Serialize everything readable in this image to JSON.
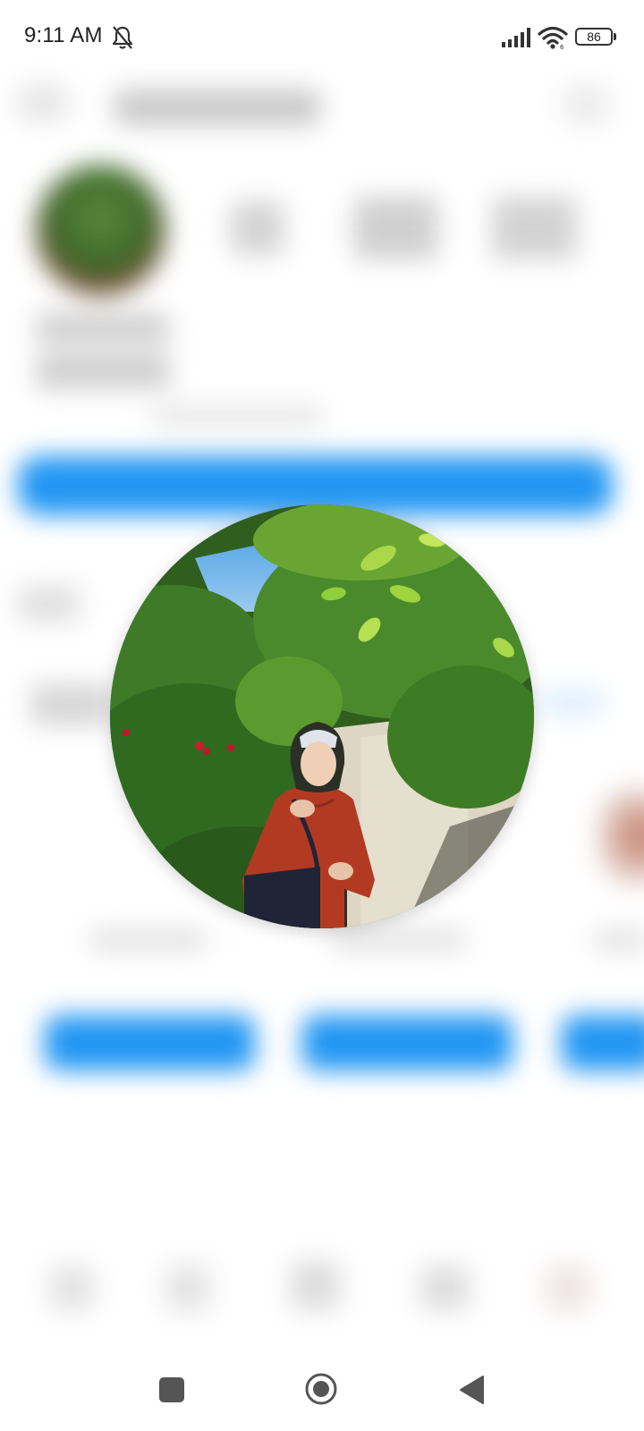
{
  "status_bar": {
    "time": "9:11 AM",
    "battery_level": "86",
    "icons": [
      "do-not-disturb-icon",
      "signal-icon",
      "wifi-icon",
      "battery-icon"
    ]
  },
  "profile_picture": {
    "description_icon": "profile-photo"
  },
  "nav_bar": {
    "icons": [
      "recents-icon",
      "home-icon",
      "back-icon"
    ]
  },
  "colors": {
    "accent_blue": "#2196f3",
    "status_text": "#222222"
  }
}
